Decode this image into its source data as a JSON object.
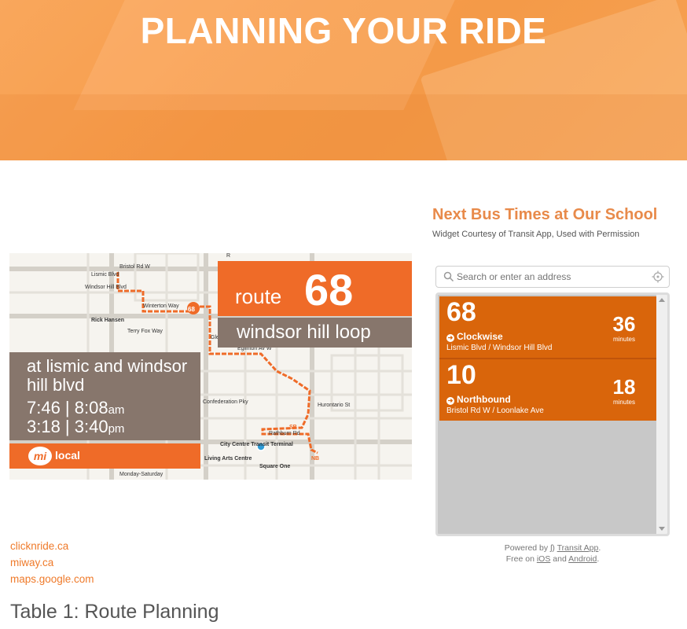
{
  "hero": {
    "title": "PLANNING YOUR RIDE"
  },
  "map": {
    "route_word": "route",
    "route_number": "68",
    "loop_name": "windsor hill loop",
    "stop_name": "at lismic and windsor hill blvd",
    "times_line1": "7:46 | 8:08",
    "times_line1_suffix": "am",
    "times_line2": "3:18 | 3:40",
    "times_line2_suffix": "pm",
    "brand": "mi",
    "brand_label": "local",
    "streets": {
      "bristol": "Bristol Rd W",
      "lismic": "Lismic Blvd",
      "windsor_hill": "Windsor Hill Blvd",
      "terry_fox": "Terry Fox Way",
      "winterton": "Winterton Way",
      "rick_hansen": "Rick Hansen",
      "glen_erin": "Glen Erin Way",
      "eglinton": "Eglinton Av W",
      "confederation": "Confederation Pky",
      "city_centre": "City Centre Transit Terminal",
      "rathburn": "Rathburn Rd",
      "hurontario": "Hurontario St",
      "living_arts": "Living Arts Centre",
      "square_one": "Square One",
      "monday_saturday": "Monday-Saturday",
      "sb": "SB",
      "nb": "NB",
      "r": "R"
    }
  },
  "links": [
    "clicknride.ca",
    "miway.ca",
    "maps.google.com"
  ],
  "caption": "Table 1: Route Planning",
  "widget": {
    "title": "Next Bus Times at Our School",
    "subtitle": "Widget Courtesy of Transit App, Used with Permission",
    "search_placeholder": "Search or enter an address",
    "cards": [
      {
        "route": "68",
        "direction": "Clockwise",
        "stop": "Lismic Blvd / Windsor Hill Blvd",
        "minutes": "36",
        "minutes_label": "minutes"
      },
      {
        "route": "10",
        "direction": "Northbound",
        "stop": "Bristol Rd W / Loonlake Ave",
        "minutes": "18",
        "minutes_label": "minutes"
      }
    ],
    "powered_by": "Powered by",
    "transit_app": "Transit App",
    "free_on": "Free on",
    "ios": "iOS",
    "and": "and",
    "android": "Android"
  },
  "colors": {
    "accent": "#ef6b28",
    "card": "#d9650b",
    "link": "#ef7a2a",
    "brown": "#87766c"
  }
}
